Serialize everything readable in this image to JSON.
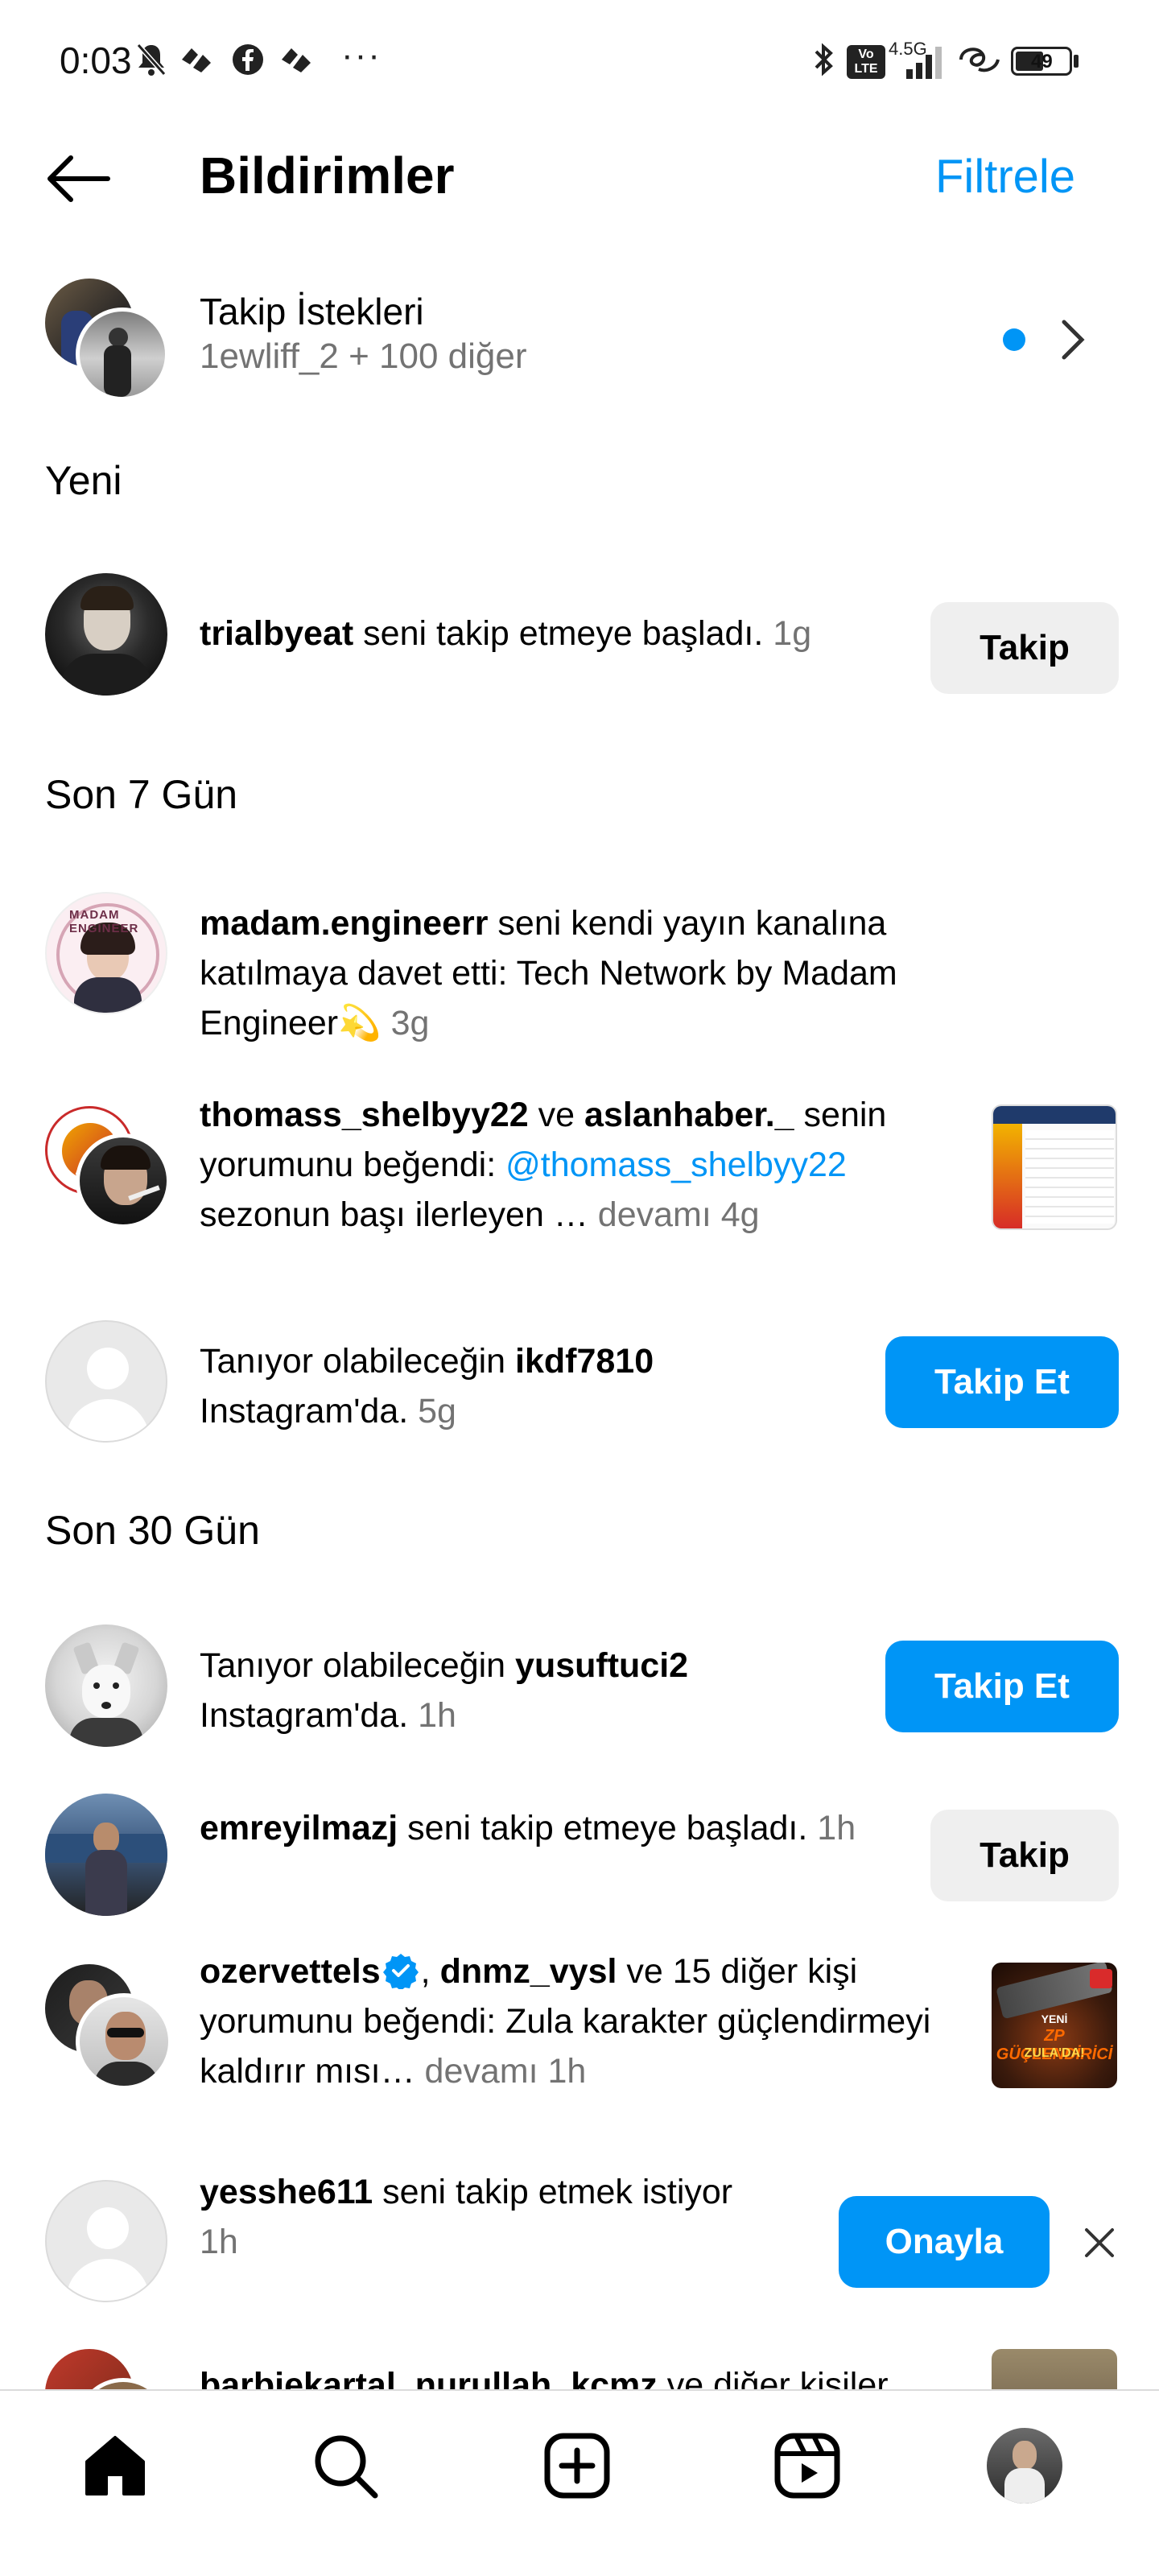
{
  "status_bar": {
    "time": "0:03",
    "dots": "···",
    "network_type": "4.5G",
    "volte": "Vo LTE",
    "battery": "49"
  },
  "header": {
    "title": "Bildirimler",
    "filter_label": "Filtrele"
  },
  "follow_requests": {
    "title": "Takip İstekleri",
    "subtitle": "1ewliff_2 + 100 diğer"
  },
  "sections": {
    "new": "Yeni",
    "last7": "Son 7 Gün",
    "last30": "Son 30 Gün"
  },
  "notifications": {
    "n1": {
      "user": "trialbyeat",
      "text": " seni takip etmeye başladı.",
      "time": " 1g",
      "button": "Takip"
    },
    "n2": {
      "user": "madam.engineerr",
      "text": " seni kendi yayın kanalına katılmaya davet etti: Tech Network by Madam Engineer💫",
      "time": " 3g"
    },
    "n3": {
      "user1": "thomass_shelbyy22",
      "and": " ve ",
      "user2": "aslanhaber._",
      "text": " senin yorumunu beğendi: ",
      "mention": "@thomass_shelbyy22",
      "text2": " sezonun başı ilerleyen … ",
      "more": "devamı",
      "time": " 4g"
    },
    "n4": {
      "prefix": "Tanıyor olabileceğin ",
      "user": "ikdf7810",
      "suffix": " Instagram'da.",
      "time": " 5g",
      "button": "Takip Et"
    },
    "n5": {
      "prefix": "Tanıyor olabileceğin ",
      "user": "yusuftuci2",
      "suffix": " Instagram'da.",
      "time": " 1h",
      "button": "Takip Et"
    },
    "n6": {
      "user": "emreyilmazj",
      "text": " seni takip etmeye başladı.",
      "time": " 1h",
      "button": "Takip"
    },
    "n7": {
      "user1": "ozervettels",
      "sep": ", ",
      "user2": "dnmz_vysl",
      "text": " ve 15 diğer kişi yorumunu beğendi: Zula karakter güçlendirmeyi kaldırır mısı… ",
      "more": "devamı",
      "time": " 1h",
      "thumb_line1": "YENİ",
      "thumb_line2": "ZP GÜÇLENDİRİCİ",
      "thumb_line3": "ZULA'DA!"
    },
    "n8": {
      "user": "yesshe611",
      "text": " seni takip etmek istiyor",
      "time": " 1h",
      "button": "Onayla"
    },
    "n9": {
      "user1": "barbiekartal",
      "sep": ", ",
      "user2": "nurullah_kcmz",
      "text": " ve diğer kişiler"
    }
  },
  "bottom_nav": [
    "home-icon",
    "search-icon",
    "create-icon",
    "reels-icon",
    "profile-avatar"
  ]
}
